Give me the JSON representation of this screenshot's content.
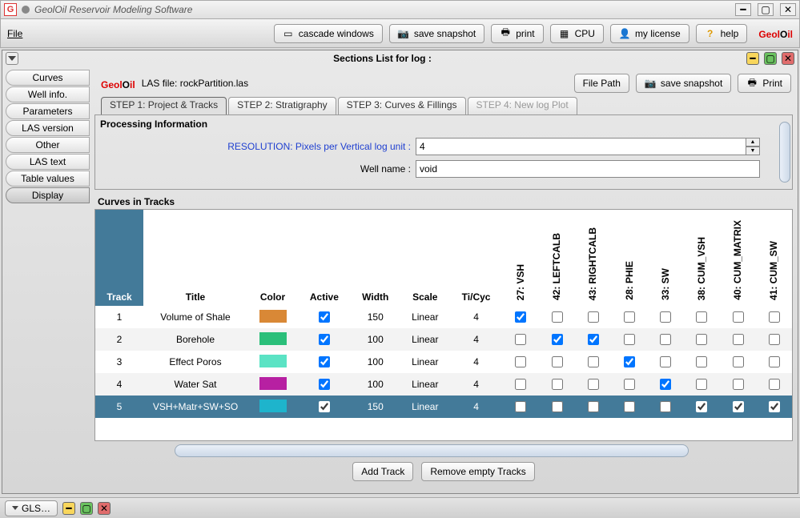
{
  "window": {
    "title": "GeolOil Reservoir Modeling Software"
  },
  "menubar": {
    "file": "File"
  },
  "toolbar": {
    "cascade": "cascade windows",
    "snapshot": "save snapshot",
    "print": "print",
    "cpu": "CPU",
    "license": "my license",
    "help": "help"
  },
  "brand": {
    "p1": "Geol",
    "p2": "O",
    "p3": "il"
  },
  "inner": {
    "title": "Sections List for log :"
  },
  "sidebar": {
    "items": [
      {
        "label": "Curves"
      },
      {
        "label": "Well info."
      },
      {
        "label": "Parameters"
      },
      {
        "label": "LAS version"
      },
      {
        "label": "Other"
      },
      {
        "label": "LAS text"
      },
      {
        "label": "Table values"
      },
      {
        "label": "Display"
      }
    ],
    "activeIndex": 7
  },
  "header": {
    "las_label": "LAS file:",
    "las_name": "rockPartition.las",
    "file_path": "File Path",
    "snapshot": "save snapshot",
    "print": "Print"
  },
  "steps": [
    {
      "label": "STEP 1: Project & Tracks",
      "state": "active"
    },
    {
      "label": "STEP 2: Stratigraphy",
      "state": "normal"
    },
    {
      "label": "STEP 3: Curves & Fillings",
      "state": "normal"
    },
    {
      "label": "STEP 4: New log Plot",
      "state": "disabled"
    }
  ],
  "processing": {
    "title": "Processing Information",
    "res_label": "RESOLUTION: Pixels per Vertical log unit :",
    "res_value": "4",
    "well_label": "Well name :",
    "well_value": "void"
  },
  "curves": {
    "title": "Curves in Tracks",
    "headers": {
      "track": "Track",
      "title": "Title",
      "color": "Color",
      "active": "Active",
      "width": "Width",
      "scale": "Scale",
      "ticyc": "Ti/Cyc"
    },
    "curveCols": [
      "27: VSH",
      "42: LEFTCALB",
      "43: RIGHTCALB",
      "28: PHIE",
      "33: SW",
      "38: CUM_VSH",
      "40: CUM_MATRIX",
      "41: CUM_SW"
    ],
    "rows": [
      {
        "track": "1",
        "title": "Volume of Shale",
        "color": "#d98836",
        "active": true,
        "width": "150",
        "scale": "Linear",
        "ticyc": "4",
        "checks": [
          true,
          false,
          false,
          false,
          false,
          false,
          false,
          false
        ],
        "sel": false
      },
      {
        "track": "2",
        "title": "Borehole",
        "color": "#2bbf7a",
        "active": true,
        "width": "100",
        "scale": "Linear",
        "ticyc": "4",
        "checks": [
          false,
          true,
          true,
          false,
          false,
          false,
          false,
          false
        ],
        "sel": false
      },
      {
        "track": "3",
        "title": "Effect Poros",
        "color": "#5be3c4",
        "active": true,
        "width": "100",
        "scale": "Linear",
        "ticyc": "4",
        "checks": [
          false,
          false,
          false,
          true,
          false,
          false,
          false,
          false
        ],
        "sel": false
      },
      {
        "track": "4",
        "title": "Water Sat",
        "color": "#b720a2",
        "active": true,
        "width": "100",
        "scale": "Linear",
        "ticyc": "4",
        "checks": [
          false,
          false,
          false,
          false,
          true,
          false,
          false,
          false
        ],
        "sel": false
      },
      {
        "track": "5",
        "title": "VSH+Matr+SW+SO",
        "color": "#1eb4cc",
        "active": true,
        "width": "150",
        "scale": "Linear",
        "ticyc": "4",
        "checks": [
          false,
          false,
          false,
          false,
          false,
          true,
          true,
          true
        ],
        "sel": true
      }
    ],
    "add": "Add Track",
    "remove": "Remove empty Tracks"
  },
  "taskbar": {
    "item": "GLS…"
  }
}
